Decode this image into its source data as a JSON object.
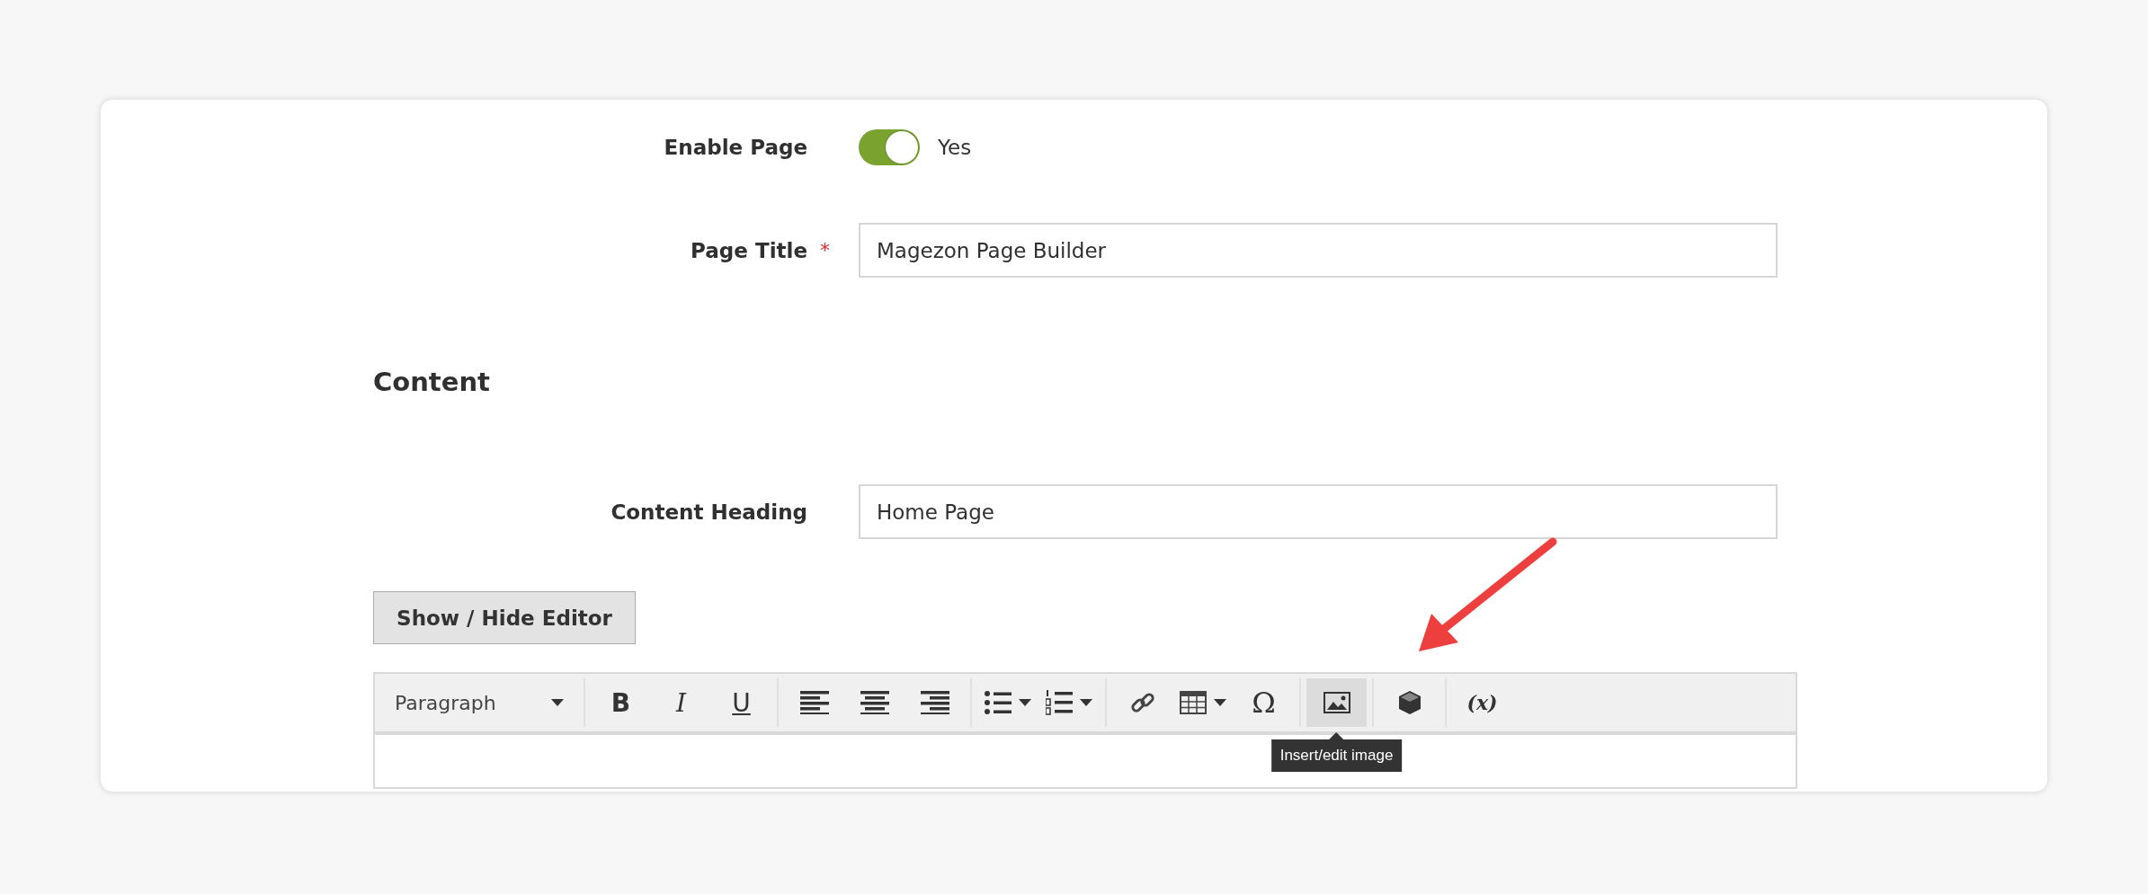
{
  "fields": [
    {
      "kind": "toggle",
      "label": "Enable Page",
      "on": true,
      "value": "Yes"
    },
    {
      "kind": "text",
      "label": "Page Title",
      "required_mark": "*",
      "value": "Magezon Page Builder"
    }
  ],
  "section": {
    "title": "Content"
  },
  "content_heading": {
    "label": "Content Heading",
    "value": "Home Page"
  },
  "editor_toggle_button": "Show / Hide Editor",
  "toolbar": {
    "format": "Paragraph",
    "tooltip": "Insert/edit image",
    "groups": [
      [
        {
          "kind": "bold",
          "text": "B",
          "selected": false
        },
        {
          "kind": "italic",
          "text": "I",
          "selected": false
        },
        {
          "kind": "underline",
          "text": "U",
          "selected": false
        }
      ],
      [
        {
          "kind": "align-left",
          "selected": false
        },
        {
          "kind": "align-center",
          "selected": false
        },
        {
          "kind": "align-right",
          "selected": false
        }
      ],
      [
        {
          "kind": "bullet-list",
          "dropdown": true,
          "selected": false
        },
        {
          "kind": "numbered-list",
          "dropdown": true,
          "selected": false
        }
      ],
      [
        {
          "kind": "link",
          "selected": false
        },
        {
          "kind": "table",
          "dropdown": true,
          "selected": false
        },
        {
          "kind": "glyph",
          "text": "Ω",
          "selected": false
        }
      ],
      [
        {
          "kind": "image",
          "selected": true
        }
      ],
      [
        {
          "kind": "widget",
          "selected": false
        }
      ],
      [
        {
          "kind": "variable",
          "text": "(x)",
          "selected": false
        }
      ]
    ]
  }
}
